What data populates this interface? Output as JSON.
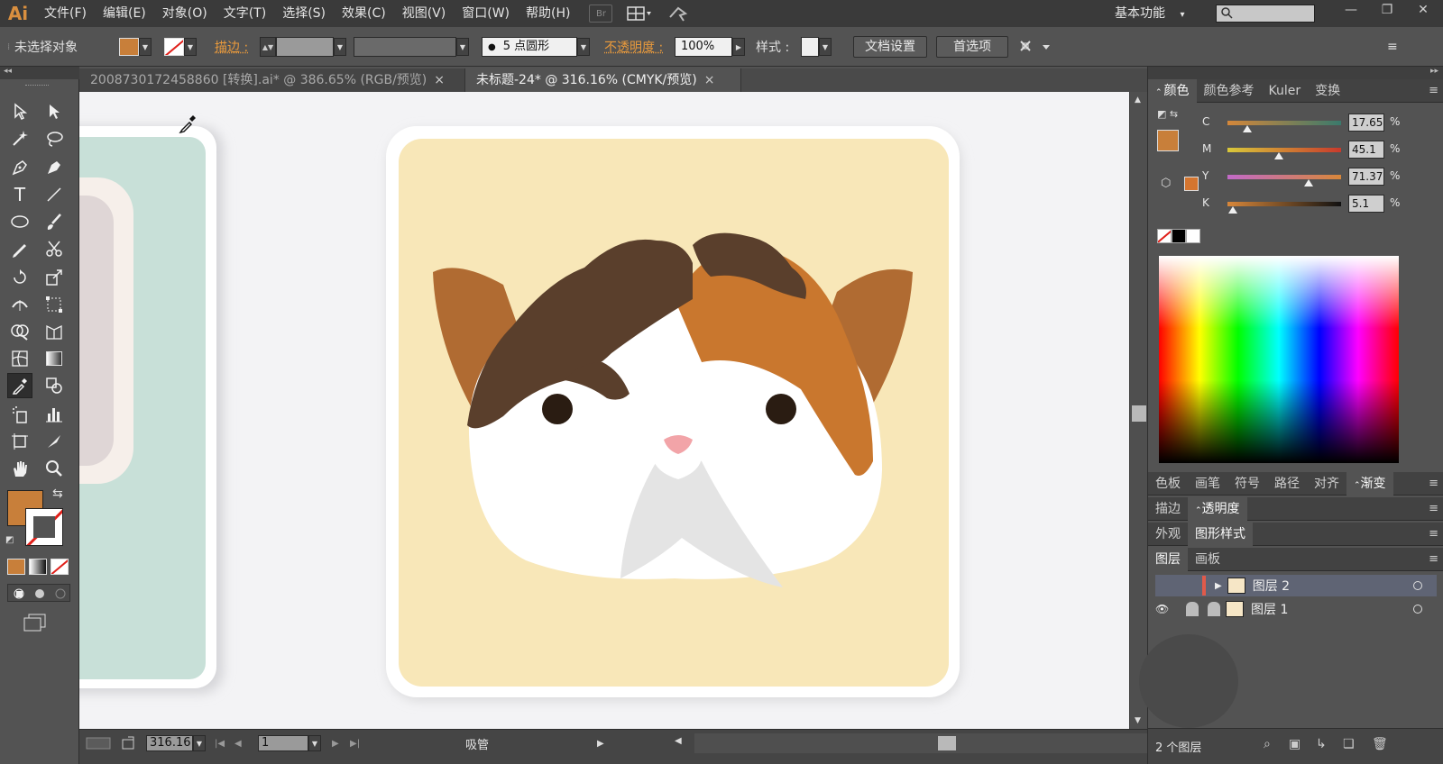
{
  "app": {
    "logo": "Ai"
  },
  "menu": [
    "文件(F)",
    "编辑(E)",
    "对象(O)",
    "文字(T)",
    "选择(S)",
    "效果(C)",
    "视图(V)",
    "窗口(W)",
    "帮助(H)"
  ],
  "menu_icons": {
    "bridge": "Br"
  },
  "workspace": {
    "label": "基本功能",
    "arrow": "▾"
  },
  "window_buttons": {
    "minimize": "—",
    "restore": "❐",
    "close": "✕"
  },
  "control_bar": {
    "selection_status": "未选择对象",
    "stroke_label": "描边 :",
    "brush_label": "5 点圆形",
    "opacity_label": "不透明度 :",
    "opacity_value": "100%",
    "style_label": "样式 :",
    "doc_setup_button": "文档设置",
    "preferences_button": "首选项",
    "panel_menu": "≡"
  },
  "tabs": [
    {
      "label": "2008730172458860 [转换].ai* @ 386.65% (RGB/预览)",
      "active": false,
      "close": "×"
    },
    {
      "label": "未标题-24* @ 316.16% (CMYK/预览)",
      "active": true,
      "close": "×"
    }
  ],
  "colors": {
    "fill": "#c87f3a",
    "panel_bg": "#535353",
    "card_bg": "#f8e7b8",
    "cat_dark": "#5a3f2c",
    "cat_orange": "#c9772e",
    "cat_ear": "#b06b32",
    "white_card_bg": "#c8e0d8"
  },
  "color_panel": {
    "tabs": [
      "颜色",
      "颜色参考",
      "Kuler",
      "变换"
    ],
    "sliders": [
      {
        "label": "C",
        "value": "17.65",
        "percent": 17.65
      },
      {
        "label": "M",
        "value": "45.1",
        "percent": 45.1
      },
      {
        "label": "Y",
        "value": "71.37",
        "percent": 71.37
      },
      {
        "label": "K",
        "value": "5.1",
        "percent": 5.1
      }
    ],
    "pct": "%"
  },
  "panel_groups": {
    "group2_tabs": [
      "色板",
      "画笔",
      "符号",
      "路径",
      "对齐",
      "渐变"
    ],
    "group3_tabs": [
      "描边",
      "透明度"
    ],
    "group4_tabs": [
      "外观",
      "图形样式"
    ],
    "group5_tabs": [
      "图层",
      "画板"
    ]
  },
  "layers": [
    {
      "name": "图层 2",
      "selected": true
    },
    {
      "name": "图层 1",
      "selected": false
    }
  ],
  "layers_footer": "2 个图层",
  "status_bar": {
    "zoom": "316.16",
    "page": "1",
    "tool_name": "吸管"
  }
}
